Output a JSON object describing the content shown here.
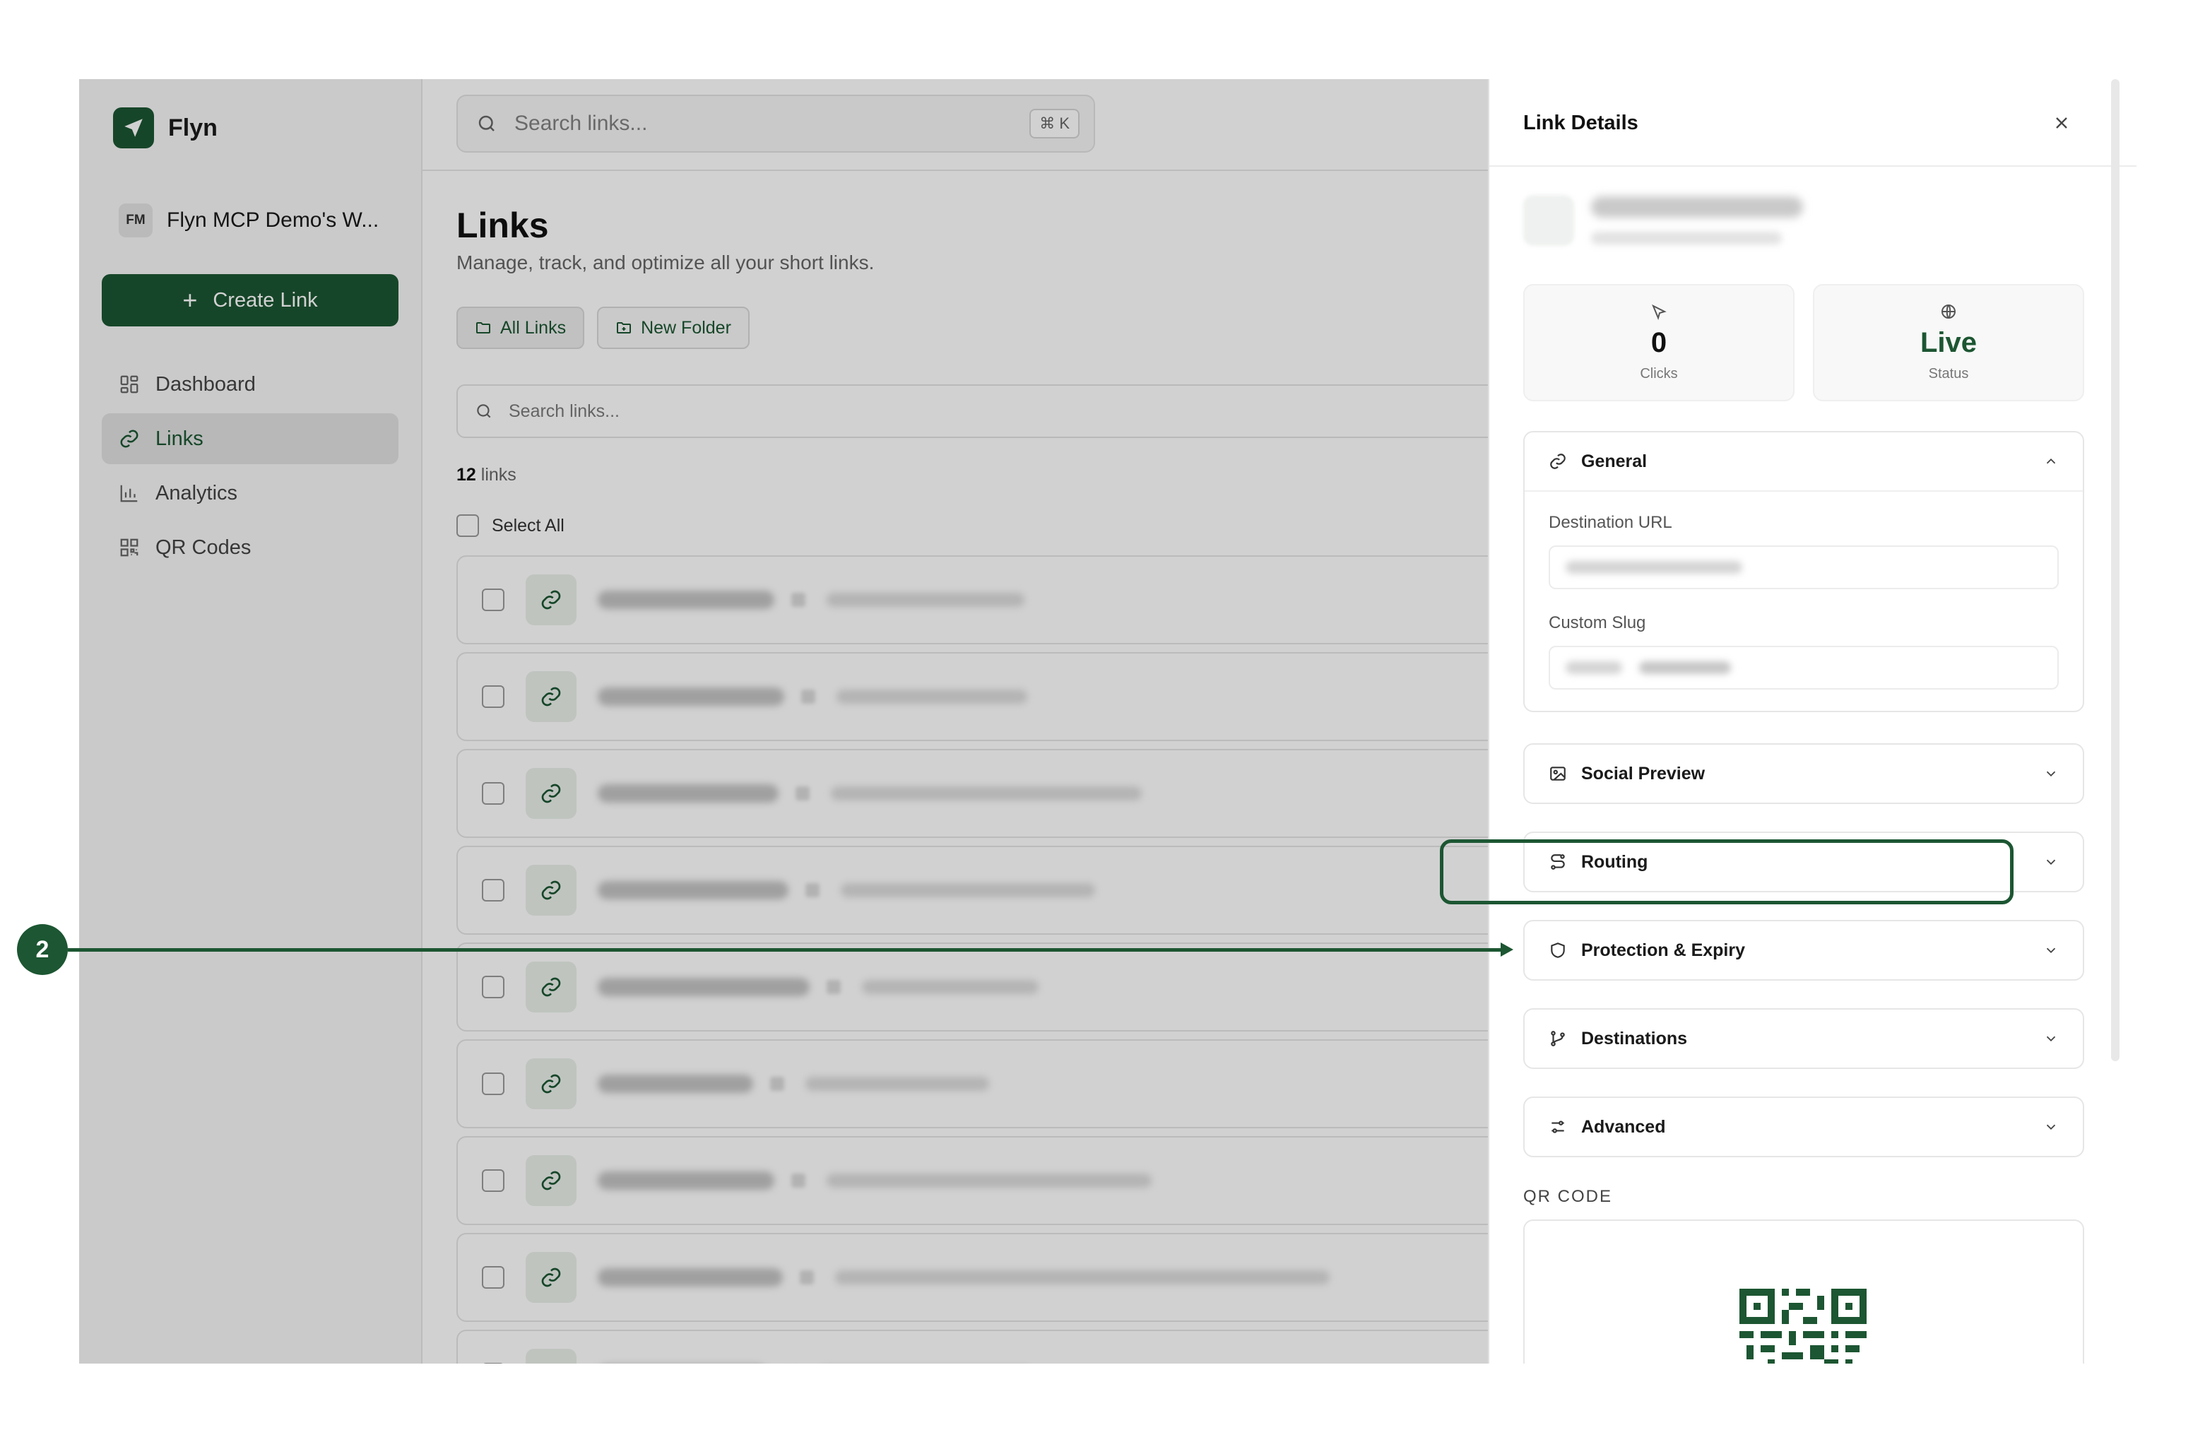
{
  "sidebar": {
    "brand": "Flyn",
    "workspace_initials": "FM",
    "workspace_name": "Flyn MCP Demo's W...",
    "create_link": "Create Link",
    "nav": [
      {
        "label": "Dashboard",
        "icon": "grid-icon"
      },
      {
        "label": "Links",
        "icon": "link-icon",
        "active": true
      },
      {
        "label": "Analytics",
        "icon": "bar-chart-icon"
      },
      {
        "label": "QR Codes",
        "icon": "qr-icon"
      }
    ]
  },
  "topbar": {
    "search_placeholder": "Search links...",
    "shortcut": "⌘ K"
  },
  "main": {
    "title": "Links",
    "subtitle": "Manage, track, and optimize all your short links.",
    "all_links": "All Links",
    "new_folder": "New Folder",
    "list_search_placeholder": "Search links...",
    "count_number": "12",
    "count_suffix": "links",
    "select_all": "Select All"
  },
  "panel": {
    "title": "Link Details",
    "stats": {
      "clicks_value": "0",
      "clicks_label": "Clicks",
      "status_value": "Live",
      "status_label": "Status"
    },
    "sections": {
      "general": "General",
      "destination_url_label": "Destination URL",
      "custom_slug_label": "Custom Slug",
      "social_preview": "Social Preview",
      "routing": "Routing",
      "protection_expiry": "Protection & Expiry",
      "destinations": "Destinations",
      "advanced": "Advanced"
    },
    "qr_label": "QR CODE"
  },
  "annotation": {
    "step": "2"
  },
  "colors": {
    "brand": "#1c5632",
    "accent_bg": "#e9efea"
  }
}
